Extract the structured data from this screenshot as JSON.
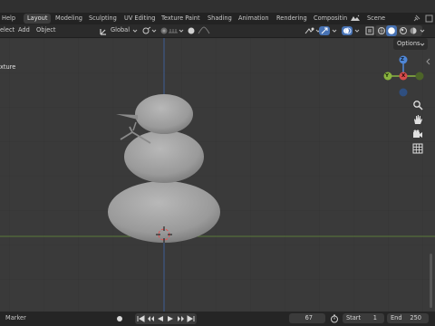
{
  "menu": {
    "help": "Help",
    "select": "elect",
    "add": "Add",
    "object": "Object"
  },
  "tabs": [
    "Layout",
    "Modeling",
    "Sculpting",
    "UV Editing",
    "Texture Paint",
    "Shading",
    "Animation",
    "Rendering",
    "Compositin"
  ],
  "active_tab": "Layout",
  "scene": {
    "label": "Scene"
  },
  "header": {
    "orientation": "Global"
  },
  "viewport": {
    "options_label": "Options",
    "overlay_text": "xture",
    "axes": {
      "x": "X",
      "y": "Y",
      "z": "Z"
    }
  },
  "timeline": {
    "marker_label": "Marker",
    "current_frame": "67",
    "start_label": "Start",
    "start_value": "1",
    "end_label": "End",
    "end_value": "250"
  },
  "colors": {
    "accent": "#4772b3",
    "x_axis": "#d64b4b",
    "y_axis": "#8ab43f",
    "z_axis": "#4f86d6",
    "grid_y_line": "#4f6b3a",
    "grid_z_line": "#3e5f94"
  }
}
